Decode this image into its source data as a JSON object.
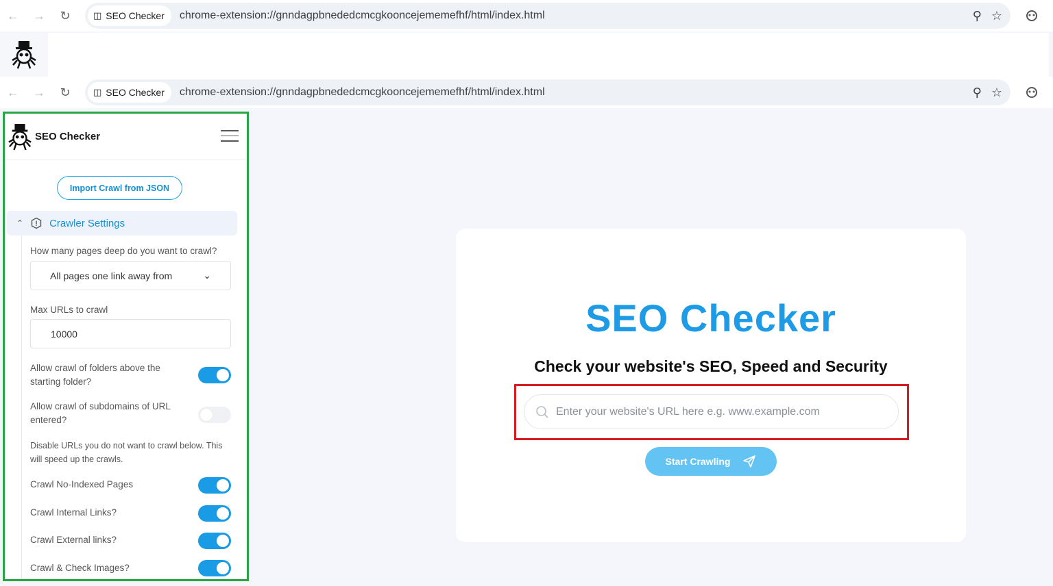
{
  "browser_top": {
    "tab_chip_label": "SEO Checker",
    "url": "chrome-extension://gnndagpbnededcmcgkooncejememefhf/html/index.html"
  },
  "browser_inner": {
    "tab_chip_label": "SEO Checker",
    "url": "chrome-extension://gnndagpbnededcmcgkooncejememefhf/html/index.html"
  },
  "sidebar": {
    "app_title": "SEO Checker",
    "import_button": "Import Crawl from JSON",
    "section_title": "Crawler Settings",
    "depth_label": "How many pages deep do you want to crawl?",
    "depth_selected": "All pages one link away from",
    "max_urls_label": "Max URLs to crawl",
    "max_urls_value": "10000",
    "folders_label": "Allow crawl of folders above the starting folder?",
    "folders_on": true,
    "subdomains_label": "Allow crawl of subdomains of URL entered?",
    "subdomains_on": false,
    "disable_note": "Disable URLs you do not want to crawl below. This will speed up the crawls.",
    "toggles": [
      {
        "label": "Crawl No-Indexed Pages",
        "on": true
      },
      {
        "label": "Crawl Internal Links?",
        "on": true
      },
      {
        "label": "Crawl External links?",
        "on": true
      },
      {
        "label": "Crawl & Check Images?",
        "on": true
      }
    ]
  },
  "main": {
    "title": "SEO Checker",
    "subtitle": "Check your website's SEO, Speed and Security",
    "search_placeholder": "Enter your website's URL here e.g. www.example.com",
    "start_button": "Start Crawling"
  },
  "colors": {
    "accent": "#1e9be6",
    "button": "#63c3f2",
    "sidebar_frame": "#26a641",
    "highlight_frame": "#d81a22"
  }
}
